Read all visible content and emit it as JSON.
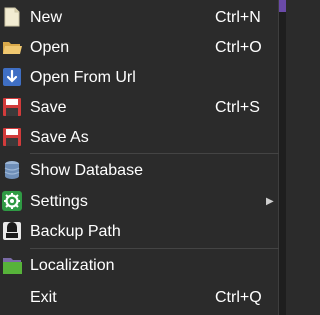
{
  "menu": {
    "items": [
      {
        "label": "New",
        "shortcut": "Ctrl+N",
        "icon": "new-file-icon"
      },
      {
        "label": "Open",
        "shortcut": "Ctrl+O",
        "icon": "folder-icon"
      },
      {
        "label": "Open From Url",
        "shortcut": "",
        "icon": "download-arrow-icon"
      },
      {
        "label": "Save",
        "shortcut": "Ctrl+S",
        "icon": "floppy-disk-icon"
      },
      {
        "label": "Save As",
        "shortcut": "",
        "icon": "floppy-disk-icon"
      },
      {
        "label": "Show Database",
        "shortcut": "",
        "icon": "database-icon"
      },
      {
        "label": "Settings",
        "shortcut": "",
        "icon": "gear-icon",
        "submenu_arrow": "▶"
      },
      {
        "label": "Backup Path",
        "shortcut": "",
        "icon": "drive-icon"
      },
      {
        "label": "Localization",
        "shortcut": "",
        "icon": "localization-icon"
      },
      {
        "label": "Exit",
        "shortcut": "Ctrl+Q",
        "icon": ""
      }
    ]
  },
  "colors": {
    "background": "#2b2b2b",
    "text": "#ffffff",
    "separator": "#444444",
    "accent": "#6a4aa8"
  }
}
